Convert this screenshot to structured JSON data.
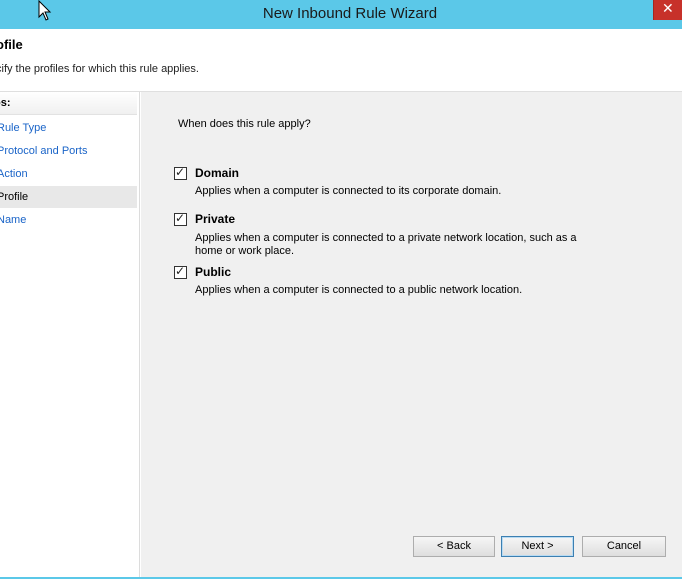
{
  "window": {
    "title": "New Inbound Rule Wizard"
  },
  "header": {
    "title": "ofile",
    "subtitle": "cify the profiles for which this rule applies."
  },
  "steps": {
    "heading": "os:",
    "items": [
      {
        "label": "Rule Type"
      },
      {
        "label": "Protocol and Ports"
      },
      {
        "label": "Action"
      },
      {
        "label": "Profile"
      },
      {
        "label": "Name"
      }
    ]
  },
  "main": {
    "question": "When does this rule apply?",
    "options": [
      {
        "label": "Domain",
        "checked": true,
        "description": "Applies when a computer is connected to its corporate domain."
      },
      {
        "label": "Private",
        "checked": true,
        "description": "Applies when a computer is connected to a private network location, such as a home or work place."
      },
      {
        "label": "Public",
        "checked": true,
        "description": "Applies when a computer is connected to a public network location."
      }
    ]
  },
  "buttons": {
    "back": "< Back",
    "next": "Next >",
    "cancel": "Cancel"
  },
  "colors": {
    "titlebar": "#5bc8e8",
    "close": "#c7312a",
    "link": "#1a64c8"
  },
  "icons": {
    "close": "close-icon",
    "cursor": "mouse-cursor-icon",
    "checkbox": "checkmark-icon"
  }
}
